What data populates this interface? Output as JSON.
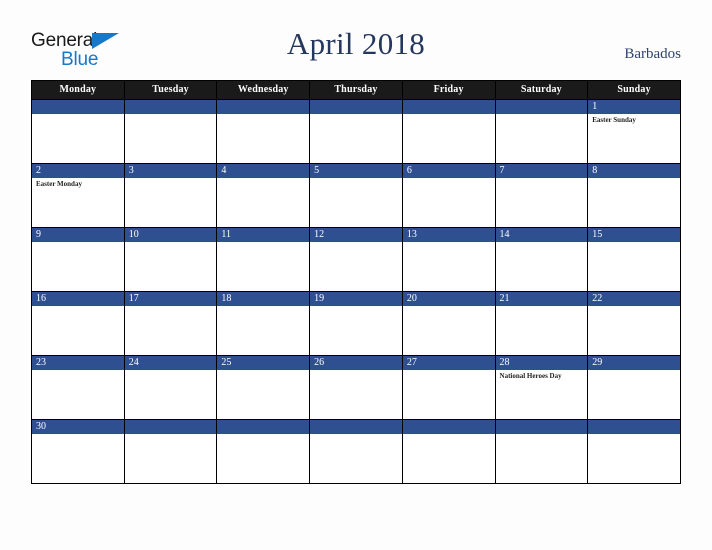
{
  "brand": {
    "name_part1": "General",
    "name_part2": "Blue",
    "triangle_icon": "blue-triangle-icon",
    "color_dark": "#1a1a1a",
    "color_blue": "#1878c8"
  },
  "header": {
    "title": "April 2018",
    "country": "Barbados",
    "title_color": "#26375e"
  },
  "calendar": {
    "accent_color": "#2e5090",
    "header_bg": "#1a1a1a",
    "weekdays": [
      "Monday",
      "Tuesday",
      "Wednesday",
      "Thursday",
      "Friday",
      "Saturday",
      "Sunday"
    ],
    "weeks": [
      [
        {
          "day": "",
          "events": []
        },
        {
          "day": "",
          "events": []
        },
        {
          "day": "",
          "events": []
        },
        {
          "day": "",
          "events": []
        },
        {
          "day": "",
          "events": []
        },
        {
          "day": "",
          "events": []
        },
        {
          "day": "1",
          "events": [
            "Easter Sunday"
          ]
        }
      ],
      [
        {
          "day": "2",
          "events": [
            "Easter Monday"
          ]
        },
        {
          "day": "3",
          "events": []
        },
        {
          "day": "4",
          "events": []
        },
        {
          "day": "5",
          "events": []
        },
        {
          "day": "6",
          "events": []
        },
        {
          "day": "7",
          "events": []
        },
        {
          "day": "8",
          "events": []
        }
      ],
      [
        {
          "day": "9",
          "events": []
        },
        {
          "day": "10",
          "events": []
        },
        {
          "day": "11",
          "events": []
        },
        {
          "day": "12",
          "events": []
        },
        {
          "day": "13",
          "events": []
        },
        {
          "day": "14",
          "events": []
        },
        {
          "day": "15",
          "events": []
        }
      ],
      [
        {
          "day": "16",
          "events": []
        },
        {
          "day": "17",
          "events": []
        },
        {
          "day": "18",
          "events": []
        },
        {
          "day": "19",
          "events": []
        },
        {
          "day": "20",
          "events": []
        },
        {
          "day": "21",
          "events": []
        },
        {
          "day": "22",
          "events": []
        }
      ],
      [
        {
          "day": "23",
          "events": []
        },
        {
          "day": "24",
          "events": []
        },
        {
          "day": "25",
          "events": []
        },
        {
          "day": "26",
          "events": []
        },
        {
          "day": "27",
          "events": []
        },
        {
          "day": "28",
          "events": [
            "National Heroes Day"
          ]
        },
        {
          "day": "29",
          "events": []
        }
      ],
      [
        {
          "day": "30",
          "events": []
        },
        {
          "day": "",
          "events": []
        },
        {
          "day": "",
          "events": []
        },
        {
          "day": "",
          "events": []
        },
        {
          "day": "",
          "events": []
        },
        {
          "day": "",
          "events": []
        },
        {
          "day": "",
          "events": []
        }
      ]
    ]
  }
}
